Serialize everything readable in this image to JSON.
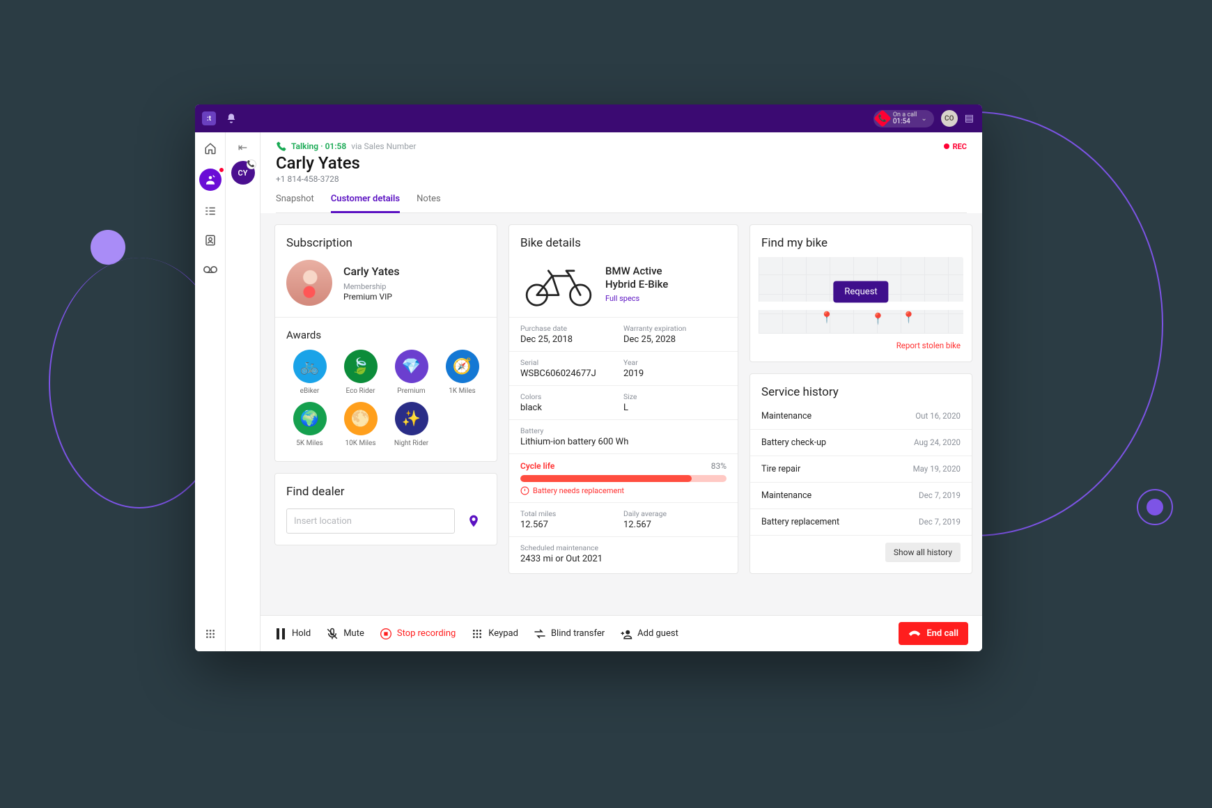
{
  "titlebar": {
    "oncall_label": "On a call",
    "oncall_timer": "01:54",
    "avatar_initials": "CO"
  },
  "conversation": {
    "initials": "CY"
  },
  "header": {
    "state": "Talking",
    "timer": "01:58",
    "via": "via Sales Number",
    "rec": "REC",
    "name": "Carly Yates",
    "phone": "+1 814-458-3728"
  },
  "tabs": {
    "snapshot": "Snapshot",
    "customer_details": "Customer details",
    "notes": "Notes"
  },
  "subscription": {
    "title": "Subscription",
    "name": "Carly Yates",
    "membership_label": "Membership",
    "membership_value": "Premium VIP"
  },
  "awards": {
    "title": "Awards",
    "items": [
      {
        "label": "eBiker",
        "emoji": "🚲",
        "bg": "#1aa3e8"
      },
      {
        "label": "Eco Rider",
        "emoji": "🍃",
        "bg": "#0c8c3a"
      },
      {
        "label": "Premium",
        "emoji": "💎",
        "bg": "#6b3fcf"
      },
      {
        "label": "1K Miles",
        "emoji": "🧭",
        "bg": "#1478d4"
      },
      {
        "label": "5K Miles",
        "emoji": "🌍",
        "bg": "#15a04e"
      },
      {
        "label": "10K Miles",
        "emoji": "🌕",
        "bg": "#ff9f1c"
      },
      {
        "label": "Night Rider",
        "emoji": "✨",
        "bg": "#2a2d87"
      }
    ]
  },
  "find_dealer": {
    "title": "Find dealer",
    "placeholder": "Insert location"
  },
  "bike": {
    "title": "Bike details",
    "name_l1": "BMW Active",
    "name_l2": "Hybrid E-Bike",
    "full_specs": "Full specs",
    "purchase_label": "Purchase date",
    "purchase_value": "Dec 25, 2018",
    "warranty_label": "Warranty expiration",
    "warranty_value": "Dec 25, 2028",
    "serial_label": "Serial",
    "serial_value": "WSBC606024677J",
    "year_label": "Year",
    "year_value": "2019",
    "colors_label": "Colors",
    "colors_value": "black",
    "size_label": "Size",
    "size_value": "L",
    "battery_label": "Battery",
    "battery_value": "Lithium-ion battery 600 Wh",
    "cycle_label": "Cycle life",
    "cycle_pct": "83%",
    "cycle_pct_num": 83,
    "cycle_warn": "Battery needs replacement",
    "miles_label": "Total miles",
    "miles_value": "12.567",
    "daily_label": "Daily average",
    "daily_value": "12.567",
    "maint_label": "Scheduled maintenance",
    "maint_value": "2433 mi or Out 2021"
  },
  "find_bike": {
    "title": "Find my bike",
    "request": "Request",
    "report": "Report stolen bike"
  },
  "service": {
    "title": "Service history",
    "items": [
      {
        "label": "Maintenance",
        "date": "Out 16, 2020"
      },
      {
        "label": "Battery check-up",
        "date": "Aug 24, 2020"
      },
      {
        "label": "Tire repair",
        "date": "May 19, 2020"
      },
      {
        "label": "Maintenance",
        "date": "Dec 7, 2019"
      },
      {
        "label": "Battery replacement",
        "date": "Dec 7, 2019"
      }
    ],
    "show_all": "Show all history"
  },
  "footer": {
    "hold": "Hold",
    "mute": "Mute",
    "stop_rec": "Stop recording",
    "keypad": "Keypad",
    "blind_transfer": "Blind transfer",
    "add_guest": "Add guest",
    "end_call": "End call"
  }
}
